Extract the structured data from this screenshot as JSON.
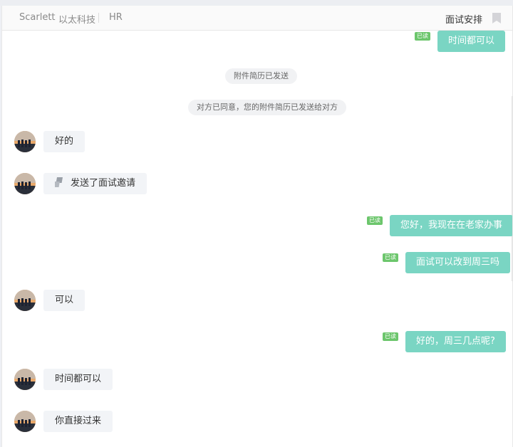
{
  "header": {
    "name": "Scarlett",
    "company": "以太科技",
    "role": "HR",
    "schedule_label": "面试安排",
    "bookmark_icon": "bookmark-icon"
  },
  "colors": {
    "sent_bubble": "#7ad5c3",
    "received_bubble": "#f2f4f7",
    "read_badge": "#6cc66c"
  },
  "messages": [
    {
      "type": "sent",
      "text": "时间都可以",
      "status": "已读"
    },
    {
      "type": "system",
      "text": "附件简历已发送"
    },
    {
      "type": "system",
      "text": "对方已同意，您的附件简历已发送给对方"
    },
    {
      "type": "received",
      "text": "好的"
    },
    {
      "type": "received",
      "text": "发送了面试邀请",
      "icon": "interview-invite-icon"
    },
    {
      "type": "sent",
      "text": "您好，我现在在老家办事",
      "status": "已读"
    },
    {
      "type": "sent",
      "text": "面试可以改到周三吗",
      "status": "已读"
    },
    {
      "type": "received",
      "text": "可以"
    },
    {
      "type": "sent",
      "text": "好的，周三几点呢?",
      "status": "已读"
    },
    {
      "type": "received",
      "text": "时间都可以"
    },
    {
      "type": "received",
      "text": "你直接过来"
    }
  ]
}
